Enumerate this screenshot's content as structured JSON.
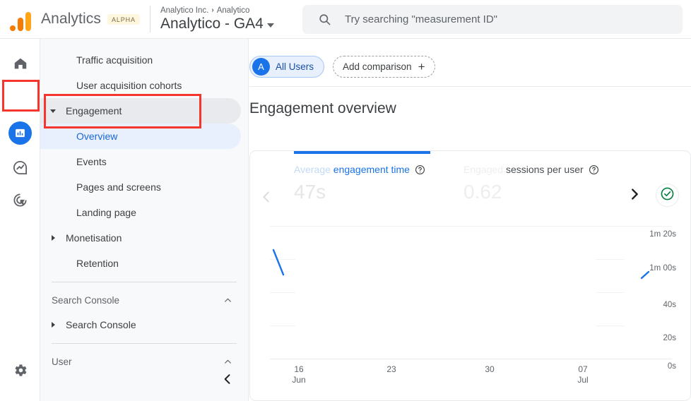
{
  "header": {
    "brand": "Analytics",
    "alpha_badge": "ALPHA",
    "breadcrumb_account": "Analytico Inc.",
    "breadcrumb_sep": "›",
    "breadcrumb_property": "Analytico",
    "property_title": "Analytico - GA4"
  },
  "search": {
    "placeholder": "Try searching \"measurement ID\"",
    "icon": "search-icon"
  },
  "rail": {
    "items": [
      {
        "icon": "home-icon",
        "name": "home"
      },
      {
        "icon": "reports-bar-chart-icon",
        "name": "reports",
        "active": true
      },
      {
        "icon": "explore-icon",
        "name": "explore"
      },
      {
        "icon": "advertising-target-icon",
        "name": "advertising"
      },
      {
        "icon": "gear-icon",
        "name": "admin"
      }
    ]
  },
  "nav": {
    "items": [
      {
        "label": "Traffic acquisition",
        "type": "item"
      },
      {
        "label": "User acquisition cohorts",
        "type": "item"
      },
      {
        "label": "Engagement",
        "type": "expandable-open",
        "state": "hovered"
      },
      {
        "label": "Overview",
        "type": "sub",
        "state": "selected"
      },
      {
        "label": "Events",
        "type": "sub"
      },
      {
        "label": "Pages and screens",
        "type": "sub"
      },
      {
        "label": "Landing page",
        "type": "sub"
      },
      {
        "label": "Monetisation",
        "type": "expandable-closed"
      },
      {
        "label": "Retention",
        "type": "item"
      }
    ],
    "sections": [
      {
        "label": "Search Console",
        "chevron": "chevron-up-icon"
      },
      {
        "label": "User",
        "chevron": "chevron-up-icon"
      }
    ],
    "search_console_child": "Search Console",
    "collapse_icon": "chevron-left-icon"
  },
  "main": {
    "chip_all_users": {
      "avatar": "A",
      "label": "All Users"
    },
    "chip_add_comparison": {
      "label": "Add comparison",
      "icon": "plus-icon"
    },
    "page_title": "Engagement overview"
  },
  "card": {
    "metrics": [
      {
        "title_fade": "Average ",
        "title_on": "engagement time",
        "help_icon": "help-circle-icon",
        "value": "47s"
      },
      {
        "title_fade": "Engaged",
        "title_on": " sessions per user",
        "help_icon": "help-circle-icon",
        "value": "0.62"
      }
    ],
    "prev_icon": "chevron-left-icon",
    "next_icon": "chevron-right-icon",
    "status_icon": "check-circle-icon"
  },
  "chart_data": {
    "type": "line",
    "title": "Average engagement time",
    "xlabel": "",
    "ylabel": "",
    "grid": true,
    "legend_position": "none",
    "line_color": "#1a73e8",
    "y_ticks": [
      "1m 20s",
      "1m 00s",
      "40s",
      "20s",
      "0s"
    ],
    "y_tick_seconds": [
      80,
      60,
      40,
      20,
      0
    ],
    "ylim": [
      0,
      80
    ],
    "x_ticks": [
      {
        "day": "16",
        "month": "Jun"
      },
      {
        "day": "23",
        "month": ""
      },
      {
        "day": "30",
        "month": ""
      },
      {
        "day": "07",
        "month": "Jul"
      }
    ],
    "note": "chart mid-render: only two short line fragments drawn",
    "series": [
      {
        "name": "Average engagement time",
        "fragments": [
          {
            "x": [
              0.055,
              0.075
            ],
            "y": [
              68,
              49
            ]
          },
          {
            "x": [
              0.845,
              0.862
            ],
            "y": [
              52,
              56
            ]
          }
        ]
      }
    ]
  }
}
